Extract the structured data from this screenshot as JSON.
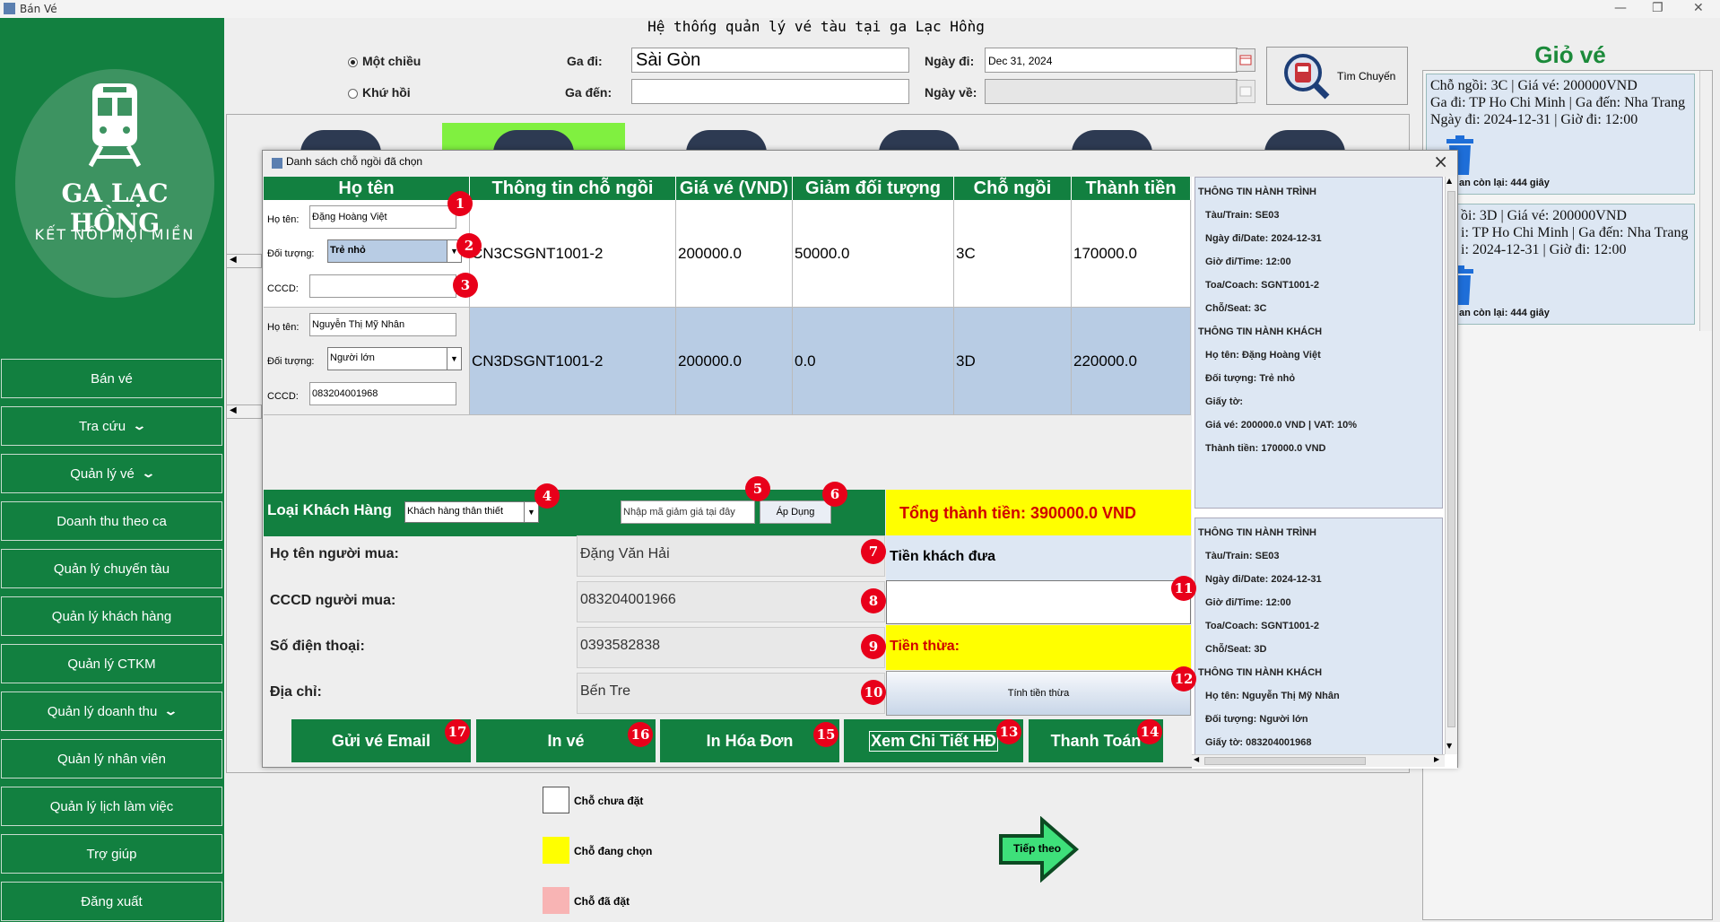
{
  "window": {
    "title": "Bán Vé"
  },
  "app_title": "Hệ thống quản lý vé tàu tại ga Lạc Hồng",
  "logo": {
    "name": "GA LẠC HỒNG",
    "slogan": "KẾT NỐI MỌI MIỀN"
  },
  "sidebar": {
    "items": [
      {
        "label": "Bán vé"
      },
      {
        "label": "Tra cứu",
        "chevron": true
      },
      {
        "label": "Quản lý vé",
        "chevron": true
      },
      {
        "label": "Doanh thu theo ca"
      },
      {
        "label": "Quản lý chuyến tàu"
      },
      {
        "label": "Quản lý khách hàng"
      },
      {
        "label": "Quản lý CTKM"
      },
      {
        "label": "Quản lý doanh thu",
        "chevron": true
      },
      {
        "label": "Quản lý nhân viên"
      },
      {
        "label": "Quản lý lịch làm việc"
      },
      {
        "label": "Trợ giúp"
      },
      {
        "label": "Đăng xuất"
      }
    ]
  },
  "search": {
    "one_way": "Một chiều",
    "round_trip": "Khứ hồi",
    "from_label": "Ga đi:",
    "from_value": "Sài Gòn",
    "to_label": "Ga đến:",
    "to_value": "",
    "depart_label": "Ngày đi:",
    "depart_value": "Dec 31, 2024",
    "return_label": "Ngày về:",
    "return_value": "",
    "find_button": "Tìm Chuyến"
  },
  "cart": {
    "title": "Giỏ vé",
    "items": [
      {
        "line1": "Chỗ ngồi: 3C |  Giá vé: 200000VND",
        "line2": "Ga đi: TP Ho Chi Minh  | Ga đến: Nha Trang",
        "line3": "Ngày đi: 2024-12-31 | Giờ đi: 12:00",
        "remaining": "an còn lại: 444 giây"
      },
      {
        "line1": "ồi: 3D |  Giá vé: 200000VND",
        "line2": "i: TP Ho Chi Minh  | Ga đến: Nha Trang",
        "line3": "i: 2024-12-31 | Giờ đi: 12:00",
        "remaining": "an còn lại: 444 giây"
      }
    ]
  },
  "legend": {
    "empty": "Chỗ chưa đặt",
    "selecting": "Chỗ đang chọn",
    "booked": "Chỗ đã đặt"
  },
  "next_button": "Tiếp theo",
  "dialog": {
    "title": "Danh sách chỗ ngồi đã chọn",
    "columns": [
      "Họ tên",
      "Thông tin chỗ ngồi",
      "Giá vé (VND)",
      "Giảm đối tượng",
      "Chỗ ngồi",
      "Thành tiền"
    ],
    "field_labels": {
      "name": "Họ tên:",
      "type": "Đối tượng:",
      "id": "CCCD:"
    },
    "rows": [
      {
        "name": "Đặng Hoàng Việt",
        "type": "Trẻ nhỏ",
        "cccd": "",
        "seat_info": "CN3CSGNT1001-2",
        "price": "200000.0",
        "discount": "50000.0",
        "seat": "3C",
        "total": "170000.0"
      },
      {
        "name": "Nguyễn Thị Mỹ Nhân",
        "type": "Người lớn",
        "cccd": "083204001968",
        "seat_info": "CN3DSGNT1001-2",
        "price": "200000.0",
        "discount": "0.0",
        "seat": "3D",
        "total": "220000.0"
      }
    ],
    "customer_type_label": "Loại Khách Hàng",
    "customer_type_value": "Khách hàng thân thiết",
    "promo_placeholder": "Nhập mã giảm giá tại đây",
    "apply_button": "Áp Dụng",
    "total_label": "Tổng thành tiền: 390000.0 VND",
    "buyer": {
      "name_label": "Họ tên người mua:",
      "name_value": "Đặng Văn Hải",
      "id_label": "CCCD người mua:",
      "id_value": "083204001966",
      "phone_label": "Số điện thoại:",
      "phone_value": "0393582838",
      "address_label": "Địa chỉ:",
      "address_value": "Bến Tre"
    },
    "cash_given_label": "Tiền khách đưa",
    "cash_given_value": "",
    "change_label": "Tiền thừa:",
    "calc_change_button": "Tính tiền thừa",
    "actions": {
      "email": "Gửi vé Email",
      "print_ticket": "In vé",
      "print_invoice": "In Hóa Đơn",
      "view_detail": "Xem Chi Tiết HĐ",
      "pay": "Thanh Toán"
    },
    "details": [
      {
        "trip_header": "THÔNG TIN HÀNH TRÌNH",
        "train": "Tàu/Train: SE03",
        "date": "Ngày đi/Date: 2024-12-31",
        "time": "Giờ đi/Time: 12:00",
        "coach": "Toa/Coach: SGNT1001-2",
        "seat": "Chỗ/Seat: 3C",
        "pax_header": "THÔNG TIN HÀNH KHÁCH",
        "name": "Họ tên: Đặng Hoàng Việt",
        "type": "Đối tượng: Trẻ nhỏ",
        "doc": "Giấy tờ:",
        "price": "Giá vé: 200000.0 VND      |    VAT: 10%",
        "total": "Thành tiền: 170000.0 VND"
      },
      {
        "trip_header": "THÔNG TIN HÀNH TRÌNH",
        "train": "Tàu/Train: SE03",
        "date": "Ngày đi/Date: 2024-12-31",
        "time": "Giờ đi/Time: 12:00",
        "coach": "Toa/Coach: SGNT1001-2",
        "seat": "Chỗ/Seat: 3D",
        "pax_header": "THÔNG TIN HÀNH KHÁCH",
        "name": "Họ tên: Nguyễn Thị Mỹ Nhân",
        "type": "Đối tượng: Người lớn",
        "doc": "Giấy tờ: 083204001968"
      }
    ]
  },
  "badges": [
    "1",
    "2",
    "3",
    "4",
    "5",
    "6",
    "7",
    "8",
    "9",
    "10",
    "11",
    "12",
    "13",
    "14",
    "15",
    "16",
    "17"
  ],
  "colors": {
    "primary_green": "#128040",
    "highlight_yellow": "#ffff00",
    "total_red": "#d00000",
    "badge_red": "#e8001a",
    "selected_row": "#b8cce4"
  }
}
